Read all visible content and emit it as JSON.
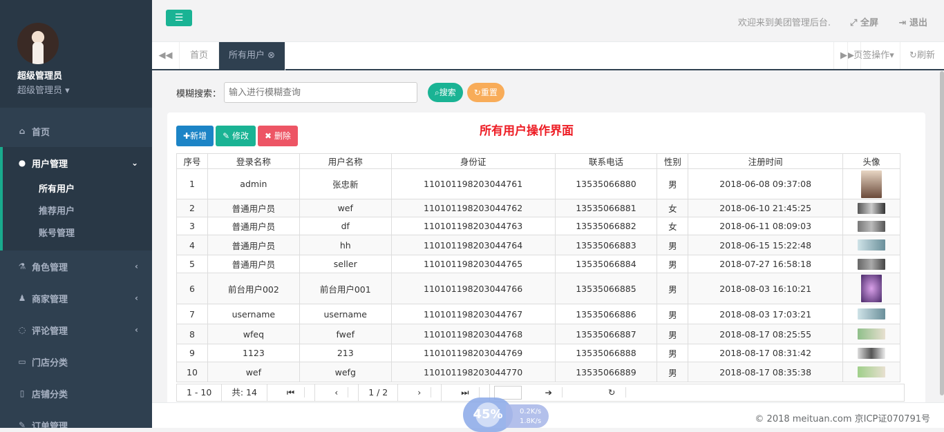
{
  "sidebar": {
    "profile": {
      "name": "超级管理员",
      "role": "超级管理员"
    },
    "menu": [
      {
        "label": "首页",
        "icon": "home-icon"
      },
      {
        "label": "用户管理",
        "icon": "user-icon",
        "children": [
          "所有用户",
          "推荐用户",
          "账号管理"
        ]
      },
      {
        "label": "角色管理",
        "icon": "flask-icon"
      },
      {
        "label": "商家管理",
        "icon": "users-icon"
      },
      {
        "label": "评论管理",
        "icon": "comment-icon"
      },
      {
        "label": "门店分类",
        "icon": "desktop-icon"
      },
      {
        "label": "店铺分类",
        "icon": "file-icon"
      },
      {
        "label": "订单管理",
        "icon": "edit-icon"
      }
    ]
  },
  "header": {
    "welcome": "欢迎来到美团管理后台.",
    "fullscreen": "全屏",
    "logout": "退出"
  },
  "tabs": {
    "home": "首页",
    "current": "所有用户",
    "ops": "页签操作",
    "refresh": "刷新"
  },
  "search": {
    "label": "模糊搜索：",
    "placeholder": "输入进行模糊查询",
    "search_btn": "搜索",
    "reset_btn": "重置"
  },
  "panel": {
    "title": "所有用户操作界面",
    "add": "新增",
    "edit": "修改",
    "delete": "删除"
  },
  "table": {
    "columns": [
      "序号",
      "登录名称",
      "用户名称",
      "身份证",
      "联系电话",
      "性别",
      "注册时间",
      "头像"
    ],
    "rows": [
      [
        "1",
        "admin",
        "张忠新",
        "110101198203044761",
        "13535066880",
        "男",
        "2018-06-08 09:37:08"
      ],
      [
        "2",
        "普通用户员",
        "wef",
        "110101198203044762",
        "13535066881",
        "女",
        "2018-06-10 21:45:25"
      ],
      [
        "3",
        "普通用户员",
        "df",
        "110101198203044763",
        "13535066882",
        "女",
        "2018-06-11 08:09:03"
      ],
      [
        "4",
        "普通用户员",
        "hh",
        "110101198203044764",
        "13535066883",
        "男",
        "2018-06-15 15:22:48"
      ],
      [
        "5",
        "普通用户员",
        "seller",
        "110101198203044765",
        "13535066884",
        "男",
        "2018-07-27 16:58:18"
      ],
      [
        "6",
        "前台用户002",
        "前台用户001",
        "110101198203044766",
        "13535066885",
        "男",
        "2018-08-03 16:10:21"
      ],
      [
        "7",
        "username",
        "username",
        "110101198203044767",
        "13535066886",
        "男",
        "2018-08-03 17:03:21"
      ],
      [
        "8",
        "wfeq",
        "fwef",
        "110101198203044768",
        "13535066887",
        "男",
        "2018-08-17 08:25:55"
      ],
      [
        "9",
        "1123",
        "213",
        "110101198203044769",
        "13535066888",
        "男",
        "2018-08-17 08:31:42"
      ],
      [
        "10",
        "wef",
        "wefg",
        "110101198203044770",
        "13535066889",
        "男",
        "2018-08-17 08:35:38"
      ]
    ]
  },
  "pager": {
    "range": "1 - 10",
    "total": "共: 14",
    "page": "1 / 2"
  },
  "widget": {
    "percent": "45%",
    "up": "0.2K/s",
    "down": "1.8K/s"
  },
  "footer": {
    "copyright": "© 2018 meituan.com 京ICP证070791号"
  },
  "colors": {
    "sidebar": "#2f4050",
    "accent": "#1ab394",
    "add": "#1c84c6",
    "delete": "#ed5565",
    "reset": "#f8ac59",
    "title": "#ed1c24"
  }
}
